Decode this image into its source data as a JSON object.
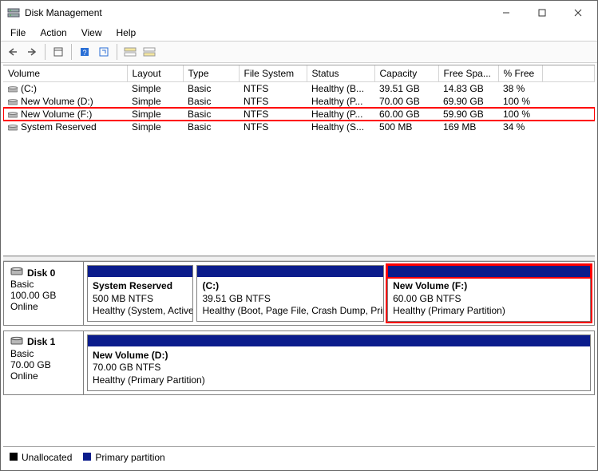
{
  "window": {
    "title": "Disk Management"
  },
  "menu": {
    "file": "File",
    "action": "Action",
    "view": "View",
    "help": "Help"
  },
  "columns": {
    "volume": "Volume",
    "layout": "Layout",
    "type": "Type",
    "filesystem": "File System",
    "status": "Status",
    "capacity": "Capacity",
    "freespace": "Free Spa...",
    "pctfree": "% Free"
  },
  "volumes": [
    {
      "name": "(C:)",
      "layout": "Simple",
      "type": "Basic",
      "fs": "NTFS",
      "status": "Healthy (B...",
      "capacity": "39.51 GB",
      "free": "14.83 GB",
      "pct": "38 %",
      "highlight": false
    },
    {
      "name": "New Volume (D:)",
      "layout": "Simple",
      "type": "Basic",
      "fs": "NTFS",
      "status": "Healthy (P...",
      "capacity": "70.00 GB",
      "free": "69.90 GB",
      "pct": "100 %",
      "highlight": false
    },
    {
      "name": "New Volume (F:)",
      "layout": "Simple",
      "type": "Basic",
      "fs": "NTFS",
      "status": "Healthy (P...",
      "capacity": "60.00 GB",
      "free": "59.90 GB",
      "pct": "100 %",
      "highlight": true
    },
    {
      "name": "System Reserved",
      "layout": "Simple",
      "type": "Basic",
      "fs": "NTFS",
      "status": "Healthy (S...",
      "capacity": "500 MB",
      "free": "169 MB",
      "pct": "34 %",
      "highlight": false
    }
  ],
  "disks": [
    {
      "name": "Disk 0",
      "type": "Basic",
      "size": "100.00 GB",
      "state": "Online",
      "parts": [
        {
          "title": "System Reserved",
          "line2": "500 MB NTFS",
          "line3": "Healthy (System, Active",
          "flex": 1.3,
          "highlight": false
        },
        {
          "title": "(C:)",
          "line2": "39.51 GB NTFS",
          "line3": "Healthy (Boot, Page File, Crash Dump, Prim",
          "flex": 2.3,
          "highlight": false
        },
        {
          "title": "New Volume  (F:)",
          "line2": "60.00 GB NTFS",
          "line3": "Healthy (Primary Partition)",
          "flex": 2.5,
          "highlight": true
        }
      ]
    },
    {
      "name": "Disk 1",
      "type": "Basic",
      "size": "70.00 GB",
      "state": "Online",
      "parts": [
        {
          "title": "New Volume  (D:)",
          "line2": "70.00 GB NTFS",
          "line3": "Healthy (Primary Partition)",
          "flex": 1,
          "highlight": false
        }
      ]
    }
  ],
  "legend": {
    "unallocated": "Unallocated",
    "primary": "Primary partition"
  },
  "colors": {
    "stripe": "#0b1c8c",
    "unalloc": "#000000"
  }
}
